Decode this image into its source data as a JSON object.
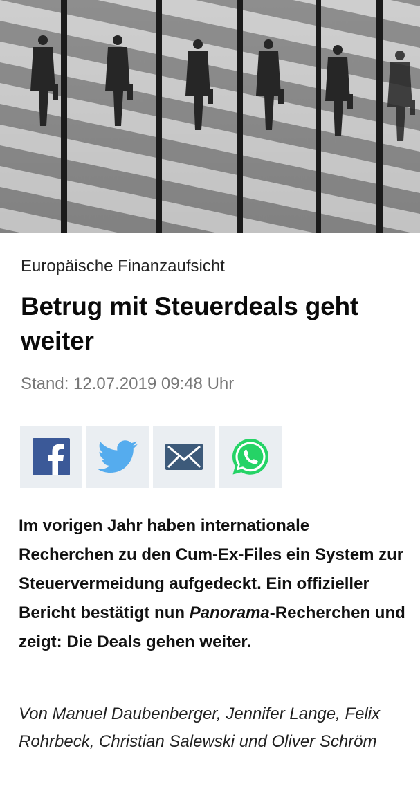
{
  "article": {
    "hero_image_alt": "Spiegelung eines Mannes mit Aktentasche in Glasfassade",
    "topline": "Europäische Finanzaufsicht",
    "headline": "Betrug mit Steuerdeals geht weiter",
    "stand": "Stand: 12.07.2019 09:48 Uhr",
    "teaser_part1": "Im vorigen Jahr haben internationale Recherchen zu den Cum-Ex-Files ein System zur Steuervermeidung aufgedeckt. Ein offizieller Bericht bestätigt nun ",
    "teaser_italic": "Panorama",
    "teaser_part2": "-Recherchen und zeigt: Die Deals gehen weiter.",
    "authors": "Von Manuel Daubenberger, Jennifer Lange, Felix Rohrbeck, Christian Salewski und Oliver Schröm"
  },
  "share": [
    {
      "name": "facebook",
      "icon": "facebook-icon",
      "color": "#3b5998"
    },
    {
      "name": "twitter",
      "icon": "twitter-icon",
      "color": "#55acee"
    },
    {
      "name": "email",
      "icon": "mail-icon",
      "color": "#3d5a7a"
    },
    {
      "name": "whatsapp",
      "icon": "whatsapp-icon",
      "color": "#25d366"
    }
  ]
}
